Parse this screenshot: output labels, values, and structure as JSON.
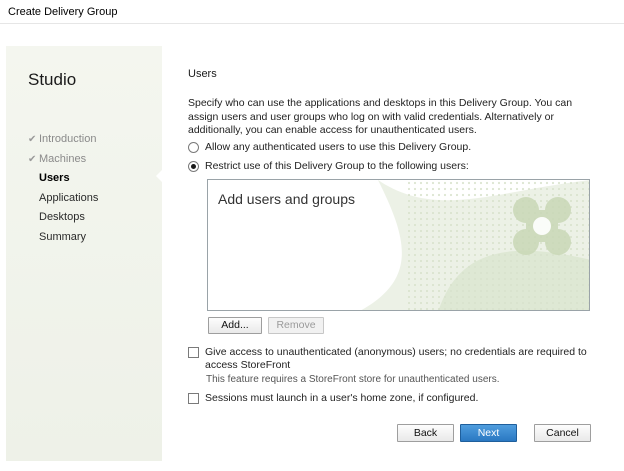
{
  "window": {
    "title": "Create Delivery Group"
  },
  "sidebar": {
    "brand": "Studio",
    "steps": [
      {
        "label": "Introduction",
        "state": "done"
      },
      {
        "label": "Machines",
        "state": "done"
      },
      {
        "label": "Users",
        "state": "current"
      },
      {
        "label": "Applications",
        "state": "pending"
      },
      {
        "label": "Desktops",
        "state": "pending"
      },
      {
        "label": "Summary",
        "state": "pending"
      }
    ]
  },
  "main": {
    "heading": "Users",
    "description": "Specify who can use the applications and desktops in this Delivery Group. You can assign users and user groups who log on with valid credentials. Alternatively or additionally, you can enable access for unauthenticated users.",
    "radio_any": {
      "label": "Allow any authenticated users to use this Delivery Group.",
      "checked": false
    },
    "radio_restrict": {
      "label": "Restrict use of this Delivery Group to the following users:",
      "checked": true
    },
    "users_box": {
      "placeholder": "Add users and groups"
    },
    "add_button": "Add...",
    "remove_button": "Remove",
    "unauth_checkbox": {
      "label": "Give access to unauthenticated (anonymous) users; no credentials are required to access StoreFront",
      "checked": false
    },
    "unauth_note": "This feature requires a StoreFront store for unauthenticated users.",
    "home_zone_checkbox": {
      "label": "Sessions must launch in a user's home zone, if configured.",
      "checked": false
    }
  },
  "footer": {
    "back": "Back",
    "next": "Next",
    "cancel": "Cancel"
  },
  "colors": {
    "accent": "#2a78c2",
    "sidebar_bg": "#eef1e8",
    "art_green": "#c9d8b6"
  }
}
